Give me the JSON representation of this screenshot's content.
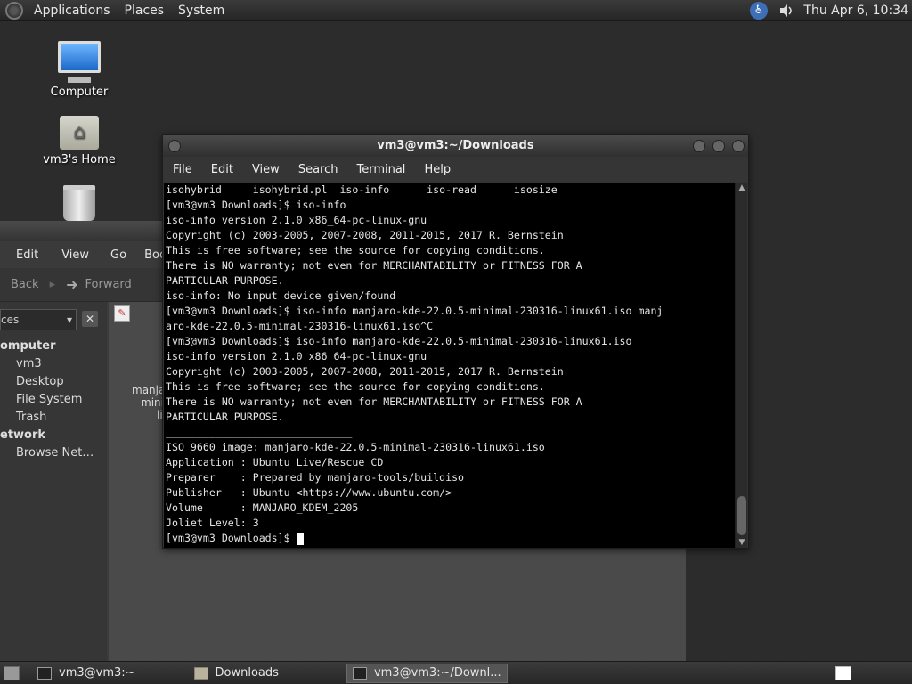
{
  "top_panel": {
    "menus": [
      "Applications",
      "Places",
      "System"
    ],
    "clock": "Thu Apr  6, 10:34",
    "icons": [
      "accessibility-icon",
      "volume-icon"
    ]
  },
  "desktop_icons": [
    "Computer",
    "vm3's Home"
  ],
  "file_manager": {
    "menus": [
      "Edit",
      "View",
      "Go",
      "Bookr"
    ],
    "toolbar": {
      "back": "Back",
      "forward": "Forward"
    },
    "side_dropdown": "ces",
    "side_groups": [
      {
        "label": "omputer",
        "items": [
          "vm3",
          "Desktop",
          "File System",
          "Trash"
        ]
      },
      {
        "label": "etwork",
        "items": [
          "Browse Net…"
        ]
      }
    ],
    "partial_file_label": [
      "manja",
      "mini",
      "li"
    ]
  },
  "terminal": {
    "title": "vm3@vm3:~/Downloads",
    "menus": [
      "File",
      "Edit",
      "View",
      "Search",
      "Terminal",
      "Help"
    ],
    "lines": [
      "isohybrid     isohybrid.pl  iso-info      iso-read      isosize",
      "[vm3@vm3 Downloads]$ iso-info",
      "iso-info version 2.1.0 x86_64-pc-linux-gnu",
      "Copyright (c) 2003-2005, 2007-2008, 2011-2015, 2017 R. Bernstein",
      "This is free software; see the source for copying conditions.",
      "There is NO warranty; not even for MERCHANTABILITY or FITNESS FOR A",
      "PARTICULAR PURPOSE.",
      "iso-info: No input device given/found",
      "[vm3@vm3 Downloads]$ iso-info manjaro-kde-22.0.5-minimal-230316-linux61.iso manj",
      "aro-kde-22.0.5-minimal-230316-linux61.iso^C",
      "[vm3@vm3 Downloads]$ iso-info manjaro-kde-22.0.5-minimal-230316-linux61.iso",
      "iso-info version 2.1.0 x86_64-pc-linux-gnu",
      "Copyright (c) 2003-2005, 2007-2008, 2011-2015, 2017 R. Bernstein",
      "This is free software; see the source for copying conditions.",
      "There is NO warranty; not even for MERCHANTABILITY or FITNESS FOR A",
      "PARTICULAR PURPOSE.",
      "______________________________",
      "ISO 9660 image: manjaro-kde-22.0.5-minimal-230316-linux61.iso",
      "Application : Ubuntu Live/Rescue CD",
      "Preparer    : Prepared by manjaro-tools/buildiso",
      "Publisher   : Ubuntu <https://www.ubuntu.com/>",
      "Volume      : MANJARO_KDEM_2205",
      "Joliet Level: 3"
    ],
    "prompt": "[vm3@vm3 Downloads]$ "
  },
  "taskbar": {
    "tasks": [
      "vm3@vm3:~",
      "Downloads",
      "vm3@vm3:~/Downl..."
    ]
  }
}
